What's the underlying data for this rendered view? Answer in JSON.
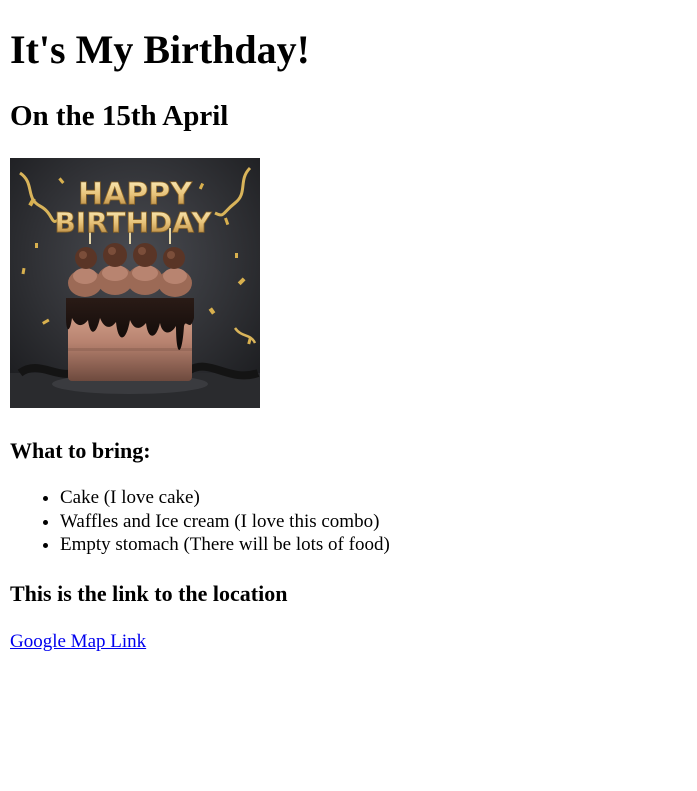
{
  "heading": "It's My Birthday!",
  "subheading": "On the 15th April",
  "image": {
    "text_line_1": "HAPPY",
    "text_line_2": "BIRTHDAY"
  },
  "bring": {
    "title": "What to bring:",
    "items": [
      "Cake (I love cake)",
      "Waffles and Ice cream (I love this combo)",
      "Empty stomach (There will be lots of food)"
    ]
  },
  "location": {
    "title": "This is the link to the location",
    "link_text": "Google Map Link"
  },
  "colors": {
    "link": "#0000ee",
    "text": "#000000",
    "background": "#ffffff"
  }
}
